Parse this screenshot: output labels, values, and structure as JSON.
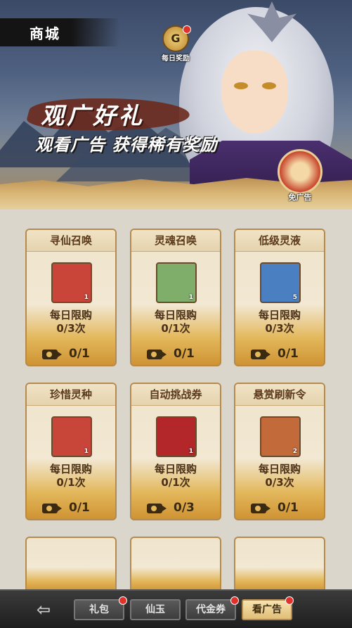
{
  "header": {
    "title": "商城",
    "daily_reward_label": "每日奖励",
    "daily_reward_icon": "medal-icon"
  },
  "banner": {
    "title": "观广好礼",
    "subtitle": "观看广告 获得稀有奖励",
    "no_ads_label": "免广告"
  },
  "cards": [
    {
      "name": "寻仙召唤",
      "icon": "summon-scroll-icon",
      "icon_color": "#c9453a",
      "qty": "1",
      "limit_label": "每日限购",
      "limit_count": "0/3次",
      "ad_count": "0/1"
    },
    {
      "name": "灵魂召唤",
      "icon": "soul-summon-icon",
      "icon_color": "#7fae6a",
      "qty": "1",
      "limit_label": "每日限购",
      "limit_count": "0/1次",
      "ad_count": "0/1"
    },
    {
      "name": "低级灵液",
      "icon": "potion-vase-icon",
      "icon_color": "#4a7fc2",
      "qty": "5",
      "limit_label": "每日限购",
      "limit_count": "0/3次",
      "ad_count": "0/1"
    },
    {
      "name": "珍惜灵种",
      "icon": "spirit-seed-icon",
      "icon_color": "#c8453a",
      "qty": "1",
      "limit_label": "每日限购",
      "limit_count": "0/1次",
      "ad_count": "0/1"
    },
    {
      "name": "自动挑战券",
      "icon": "challenge-ticket-icon",
      "icon_color": "#b3262a",
      "qty": "1",
      "limit_label": "每日限购",
      "limit_count": "0/1次",
      "ad_count": "0/3"
    },
    {
      "name": "悬赏刷新令",
      "icon": "bounty-refresh-icon",
      "icon_color": "#c26a3a",
      "qty": "2",
      "limit_label": "每日限购",
      "limit_count": "0/3次",
      "ad_count": "0/1"
    }
  ],
  "tabs": [
    {
      "label": "礼包",
      "badge": true
    },
    {
      "label": "仙玉",
      "badge": false
    },
    {
      "label": "代金券",
      "badge": true
    },
    {
      "label": "看广告",
      "badge": true,
      "active": true
    }
  ],
  "back_icon": "back-arrow-icon",
  "colors": {
    "badge": "#e0322a",
    "active_tab": "#e0be76",
    "card_gold": "#e3b85c"
  }
}
